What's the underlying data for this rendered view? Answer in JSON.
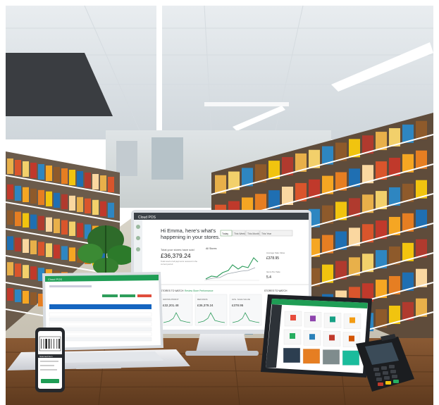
{
  "monitor": {
    "header_brand": "Cloud POS",
    "greeting_line1": "Hi Emma, here's what's",
    "greeting_line2": "happening in your stores.",
    "tabs": [
      "Today",
      "This Week",
      "This Month",
      "This Year"
    ],
    "sales_title_line1": "Total your stores have sold",
    "sales_amount": "£36,379.24",
    "sales_caption_line1": "Total result of all payments received in the",
    "sales_caption_line2": "current period",
    "chart_title": "All Stores",
    "stat1_label": "Average Sale Value",
    "stat1_value": "£378.95",
    "stat2_label": "Items Per Sale",
    "stat2_value": "5.4",
    "section_left": "STORES TO WATCH",
    "section_right": "Review Store Performance",
    "section_far": "STORES TO WATCH",
    "cards": [
      {
        "title": "GROSS PROFIT",
        "value": "£32,201.48"
      },
      {
        "title": "REFUNDS",
        "value": "£36,379.24"
      },
      {
        "title": "AVG. SALE VALUE",
        "value": "£378.95"
      }
    ]
  },
  "laptop": {
    "header_brand": "Cloud POS"
  },
  "phone": {
    "header_text": "Scanned Item"
  },
  "colors": {
    "pos_green": "#1f9d55",
    "pos_blue": "#1565c0",
    "tile_colors": [
      "#e74c3c",
      "#8e44ad",
      "#16a085",
      "#f39c12",
      "#27ae60",
      "#2980b9",
      "#c0392b",
      "#d35400",
      "#2c3e50",
      "#e67e22",
      "#7f8c8d",
      "#1abc9c"
    ]
  }
}
